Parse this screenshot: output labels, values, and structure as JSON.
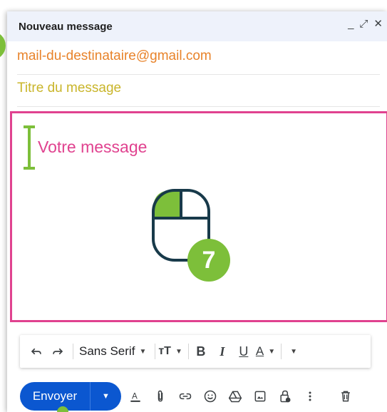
{
  "window": {
    "title": "Nouveau message",
    "controls": {
      "minimize": "_",
      "expand": "⤢",
      "close": "✕"
    }
  },
  "compose": {
    "to_value": "mail-du-destinataire@gmail.com",
    "subject_value": "Titre du message",
    "body_placeholder": "Votre message",
    "step_number": "7"
  },
  "format_toolbar": {
    "undo_icon": "undo-icon",
    "redo_icon": "redo-icon",
    "font_family": "Sans Serif",
    "size_label": "тT",
    "bold_label": "B",
    "italic_label": "I",
    "underline_label": "U",
    "text_color_label": "A"
  },
  "bottom_toolbar": {
    "send_label": "Envoyer",
    "icons": [
      "text-format-icon",
      "attach-icon",
      "link-icon",
      "emoji-icon",
      "drive-icon",
      "image-icon",
      "confidential-lock-icon",
      "more-options-icon",
      "delete-icon"
    ]
  },
  "colors": {
    "accent_pink": "#e0428f",
    "accent_green": "#7dbf3a",
    "to_orange": "#e8832a",
    "subject_yellow": "#c9b52a",
    "send_blue": "#0b57d0",
    "mouse_outline": "#183a4a"
  }
}
